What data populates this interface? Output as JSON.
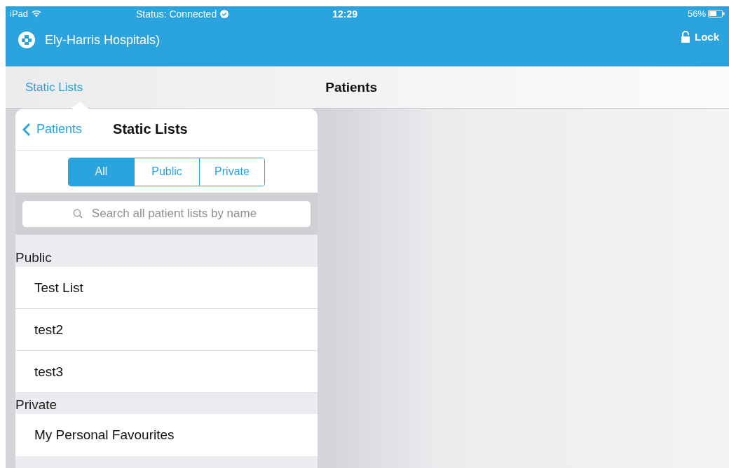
{
  "status_bar": {
    "device": "iPad",
    "status": "Status: Connected",
    "time": "12:29",
    "battery": "56%"
  },
  "app_bar": {
    "title": "Ely-Harris Hospitals)",
    "lock_button": "Lock"
  },
  "nav_bar": {
    "left_button": "Static Lists",
    "title": "Patients"
  },
  "popover": {
    "back_button": "Patients",
    "title": "Static Lists",
    "segments": [
      {
        "label": "All",
        "selected": true
      },
      {
        "label": "Public",
        "selected": false
      },
      {
        "label": "Private",
        "selected": false
      }
    ],
    "search": {
      "placeholder": "Search all patient lists by name"
    },
    "sections": [
      {
        "header": "Public",
        "items": [
          "Test List",
          "test2",
          "test3"
        ]
      },
      {
        "header": "Private",
        "items": [
          "My Personal Favourites"
        ]
      }
    ]
  }
}
